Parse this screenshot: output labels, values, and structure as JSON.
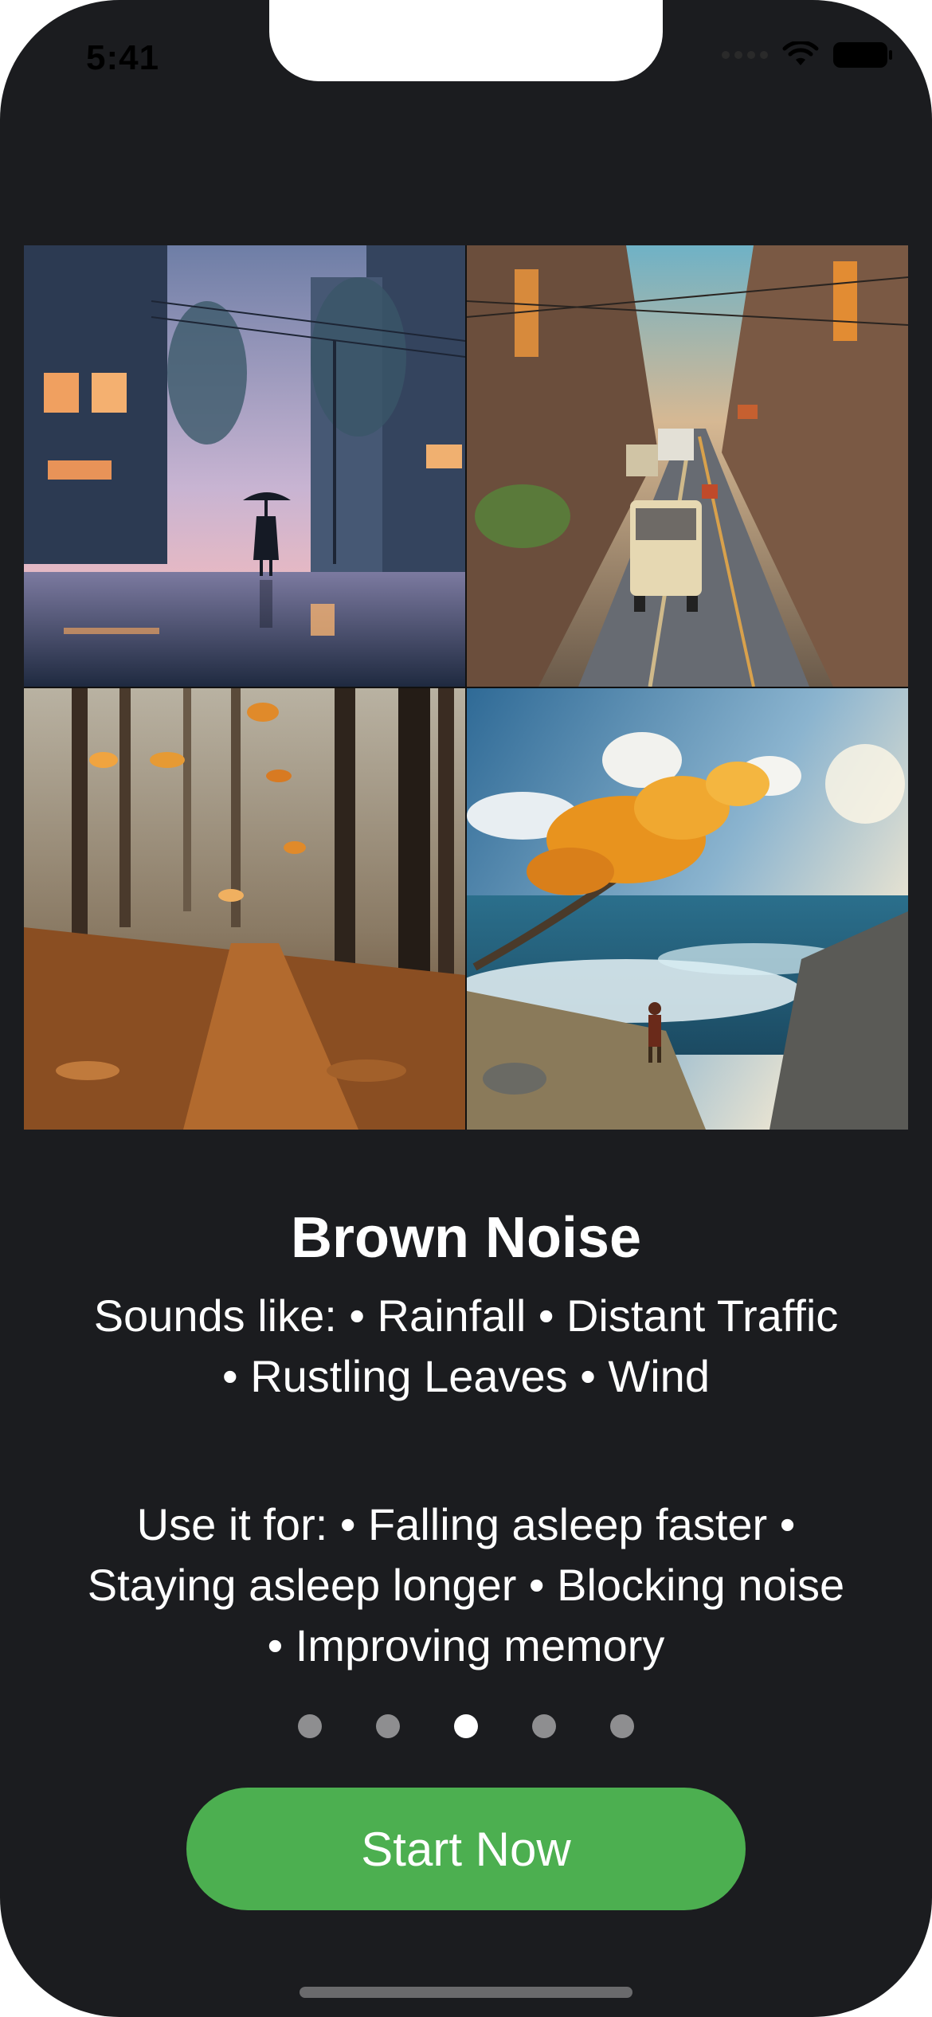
{
  "status_bar": {
    "time": "5:41",
    "icons": [
      "signal-icon",
      "wifi-icon",
      "battery-icon"
    ]
  },
  "images": [
    {
      "name": "rainfall-image"
    },
    {
      "name": "distant-traffic-image"
    },
    {
      "name": "rustling-leaves-image"
    },
    {
      "name": "wind-image"
    }
  ],
  "content": {
    "title": "Brown Noise",
    "sounds_line1": "Sounds like: • Rainfall • Distant Traffic",
    "sounds_line2": "• Rustling Leaves • Wind",
    "use_line1": "Use it for: • Falling asleep faster •",
    "use_line2": "Staying asleep longer • Blocking noise",
    "use_line3": "• Improving memory"
  },
  "pagination": {
    "total": 5,
    "active_index": 2
  },
  "cta": {
    "label": "Start Now"
  },
  "colors": {
    "background": "#1b1c1f",
    "accent": "#4caf50",
    "dot_inactive": "#8e8e90",
    "dot_active": "#ffffff"
  }
}
